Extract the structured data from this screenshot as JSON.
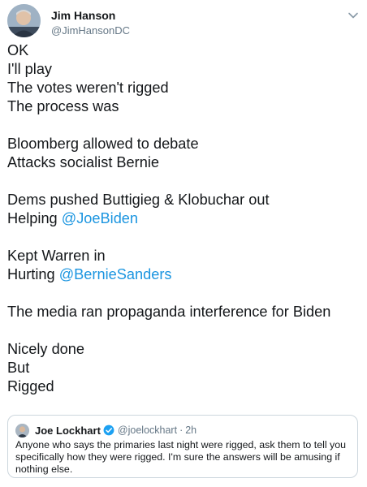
{
  "tweet": {
    "author_name": "Jim Hanson",
    "author_handle": "@JimHansonDC",
    "lines": [
      "OK",
      "I'll play",
      "The votes weren't rigged",
      "The process was",
      "",
      "Bloomberg allowed to debate",
      "Attacks socialist Bernie",
      "",
      "Dems pushed Buttigieg & Klobuchar out",
      "Helping ",
      "",
      "Kept Warren in",
      "Hurting ",
      "",
      "The media ran propaganda interference for Biden",
      "",
      "Nicely done",
      "But",
      "Rigged"
    ],
    "mentions": {
      "joe_biden": "@JoeBiden",
      "bernie_sanders": "@BernieSanders"
    }
  },
  "quoted_tweet": {
    "author_name": "Joe Lockhart",
    "author_handle": "@joelockhart",
    "separator": "·",
    "time": "2h",
    "text": "Anyone who says the primaries last night were rigged, ask them to tell you specifically how they were rigged.  I'm sure the answers will be amusing if nothing else."
  },
  "colors": {
    "link": "#1b95e0",
    "verified": "#1da1f2",
    "muted": "#657786",
    "border": "#ccd6dd"
  },
  "icons": {
    "menu": "chevron-down-icon",
    "verified": "verified-badge-icon"
  }
}
